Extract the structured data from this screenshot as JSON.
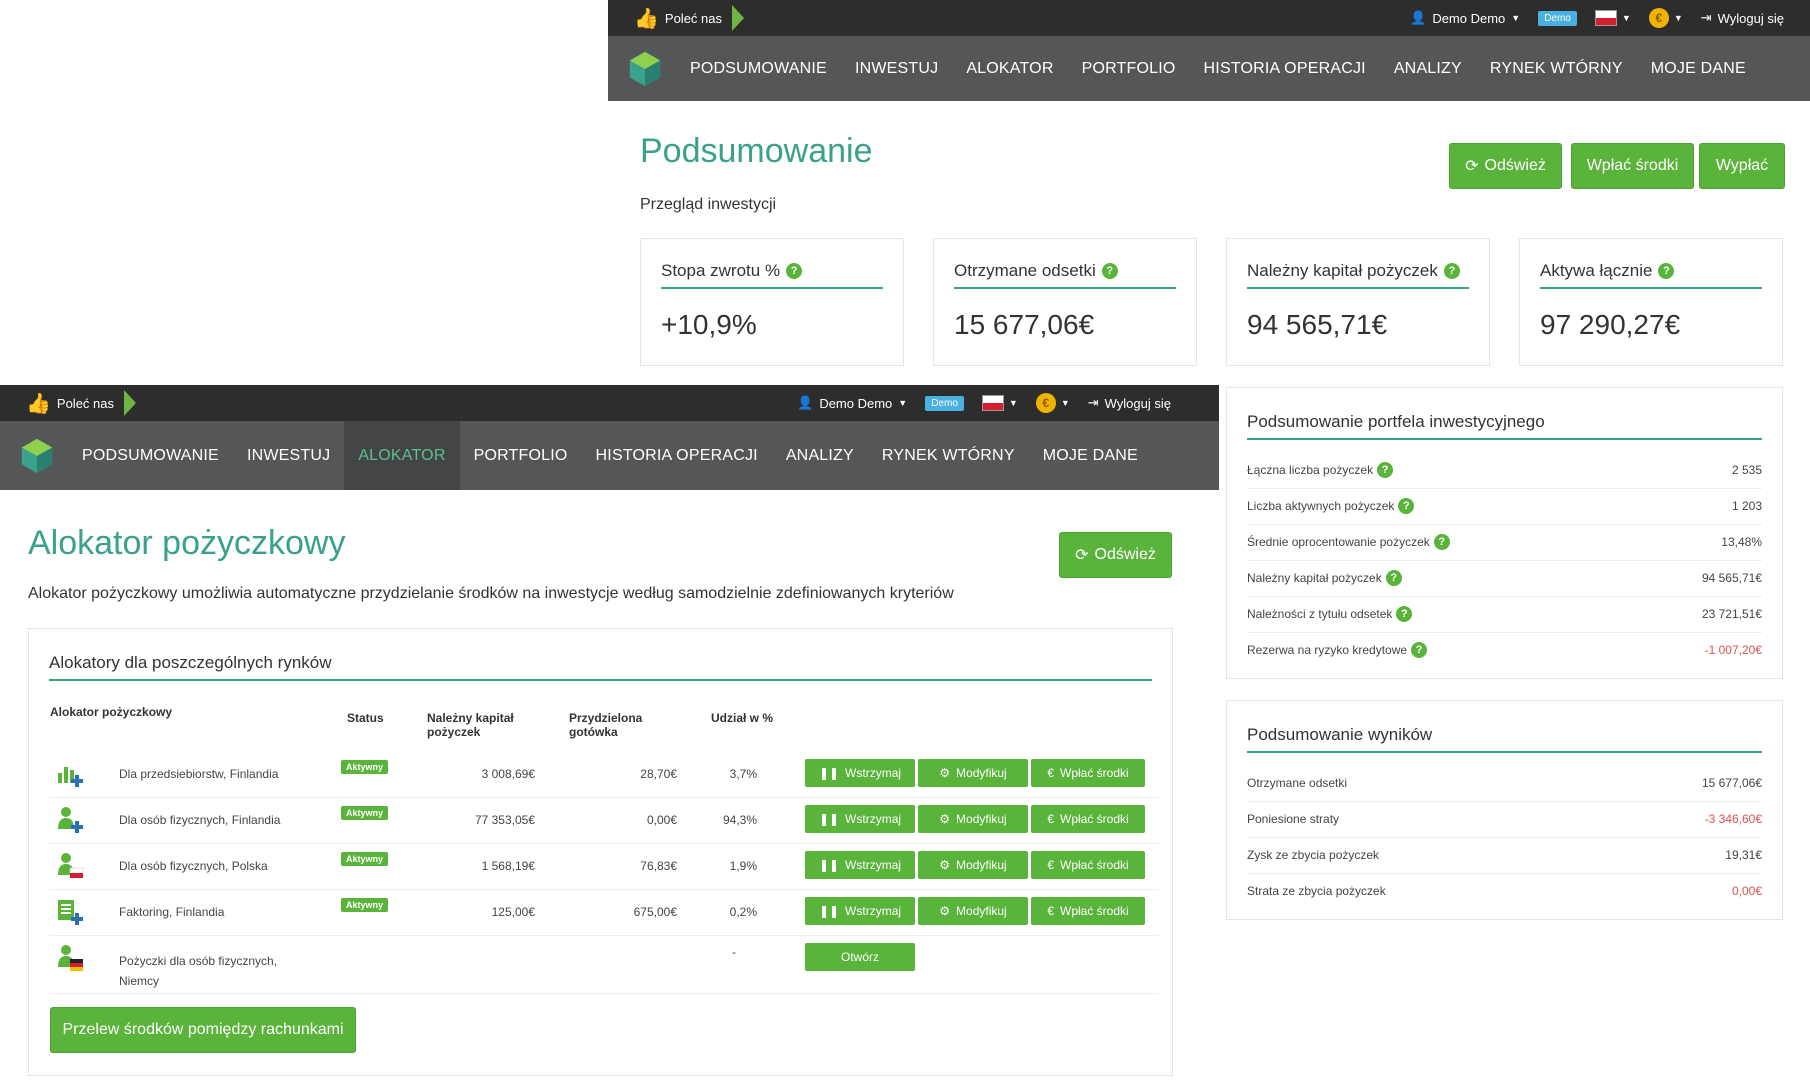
{
  "topbar": {
    "recommend": "Poleć nas",
    "user": "Demo Demo",
    "demo_badge": "Demo",
    "logout": "Wyloguj się"
  },
  "nav": {
    "items": [
      "PODSUMOWANIE",
      "INWESTUJ",
      "ALOKATOR",
      "PORTFOLIO",
      "HISTORIA OPERACJI",
      "ANALIZY",
      "RYNEK WTÓRNY",
      "MOJE DANE"
    ]
  },
  "summary": {
    "title": "Podsumowanie",
    "subtitle": "Przegląd inwestycji",
    "buttons": {
      "refresh": "Odśwież",
      "deposit": "Wpłać środki",
      "withdraw": "Wypłać"
    },
    "cards": [
      {
        "label": "Stopa zwrotu %",
        "value": "+10,9%"
      },
      {
        "label": "Otrzymane odsetki",
        "value": "15 677,06€"
      },
      {
        "label": "Należny kapitał pożyczek",
        "value": "94 565,71€"
      },
      {
        "label": "Aktywa łącznie",
        "value": "97 290,27€"
      }
    ]
  },
  "portfolio_summary": {
    "title": "Podsumowanie portfela inwestycyjnego",
    "rows": [
      {
        "label": "Łączna liczba pożyczek",
        "value": "2 535"
      },
      {
        "label": "Liczba aktywnych pożyczek",
        "value": "1 203"
      },
      {
        "label": "Średnie oprocentowanie pożyczek",
        "value": "13,48%"
      },
      {
        "label": "Należny kapitał pożyczek",
        "value": "94 565,71€"
      },
      {
        "label": "Należności z tytułu odsetek",
        "value": "23 721,51€"
      },
      {
        "label": "Rezerwa na ryzyko kredytowe",
        "value": "-1 007,20€"
      }
    ]
  },
  "results_summary": {
    "title": "Podsumowanie wyników",
    "rows": [
      {
        "label": "Otrzymane odsetki",
        "value": "15 677,06€"
      },
      {
        "label": "Poniesione straty",
        "value": "-3 346,60€"
      },
      {
        "label": "Zysk ze zbycia pożyczek",
        "value": "19,31€"
      },
      {
        "label": "Strata ze zbycia pożyczek",
        "value": "0,00€"
      }
    ]
  },
  "allocator": {
    "title": "Alokator pożyczkowy",
    "description": "Alokator pożyczkowy umożliwia automatyczne przydzielanie środków na inwestycje według samodzielnie zdefiniowanych kryteriów",
    "refresh": "Odśwież",
    "panel_title": "Alokatory dla poszczególnych rynków",
    "columns": {
      "name": "Alokator pożyczkowy",
      "status": "Status",
      "capital_1": "Należny kapitał",
      "capital_2": "pożyczek",
      "cash_1": "Przydzielona",
      "cash_2": "gotówka",
      "share": "Udział w %"
    },
    "rows": [
      {
        "name": "Dla przedsiebiorstw, Finlandia",
        "status": "Aktywny",
        "capital": "3 008,69€",
        "cash": "28,70€",
        "share": "3,7%"
      },
      {
        "name": "Dla osób fizycznych, Finlandia",
        "status": "Aktywny",
        "capital": "77 353,05€",
        "cash": "0,00€",
        "share": "94,3%"
      },
      {
        "name": "Dla osób fizycznych, Polska",
        "status": "Aktywny",
        "capital": "1 568,19€",
        "cash": "76,83€",
        "share": "1,9%"
      },
      {
        "name": "Faktoring, Finlandia",
        "status": "Aktywny",
        "capital": "125,00€",
        "cash": "675,00€",
        "share": "0,2%"
      }
    ],
    "row_buttons": {
      "pause": "Wstrzymaj",
      "modify": "Modyfikuj",
      "deposit": "Wpłać środki"
    },
    "last_row": {
      "name_1": "Pożyczki dla osób fizycznych,",
      "name_2": "Niemcy",
      "share": "-",
      "open": "Otwórz"
    },
    "transfer": "Przelew środków pomiędzy rachunkami"
  },
  "colors": {
    "accent": "#3aa18c",
    "button": "#5ab33b",
    "topbar": "#2d2d2d",
    "navbar": "#555658",
    "negative": "#d9534f"
  }
}
